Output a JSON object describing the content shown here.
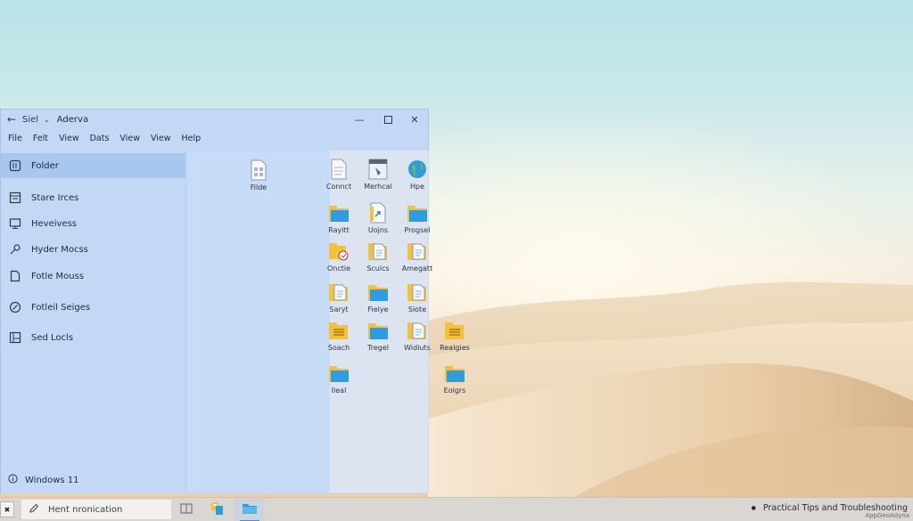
{
  "window": {
    "path_text": "Siel",
    "title": "Aderva",
    "menu": [
      "File",
      "Felt",
      "View",
      "Dats",
      "View",
      "View",
      "Help"
    ]
  },
  "nav": {
    "items": [
      {
        "label": "Folder",
        "icon": "folder-outline-icon"
      },
      {
        "label": "Stare Irces",
        "icon": "document-list-icon"
      },
      {
        "label": "Heveivess",
        "icon": "monitor-icon"
      },
      {
        "label": "Hyder Mocss",
        "icon": "link-icon"
      },
      {
        "label": "Fotle Mouss",
        "icon": "file-icon"
      },
      {
        "label": "Fotleil Seiges",
        "icon": "compass-icon"
      },
      {
        "label": "Sed Locls",
        "icon": "image-icon"
      }
    ],
    "footer": "Windows 11"
  },
  "mid_pane": {
    "item": {
      "label": "Filde",
      "icon": "document-icon"
    }
  },
  "files": [
    {
      "label": "Connct",
      "icon": "document-icon"
    },
    {
      "label": "Merhcal",
      "icon": "application-icon"
    },
    {
      "label": "Hpe",
      "icon": "globe-icon"
    },
    {
      "label": "Rayitt",
      "icon": "folder-icon"
    },
    {
      "label": "Uojns",
      "icon": "shortcut-file-icon"
    },
    {
      "label": "Progsel",
      "icon": "folder-icon"
    },
    {
      "label": "Onctie",
      "icon": "folder-badge-icon"
    },
    {
      "label": "Scuics",
      "icon": "folder-document-icon"
    },
    {
      "label": "Amegatt",
      "icon": "folder-document-icon"
    },
    {
      "label": "Saryt",
      "icon": "folder-document-icon"
    },
    {
      "label": "Fielye",
      "icon": "folder-icon"
    },
    {
      "label": "Siote",
      "icon": "folder-document-icon"
    },
    {
      "label": "Soach",
      "icon": "folder-lines-icon"
    },
    {
      "label": "Tregel",
      "icon": "folder-icon"
    },
    {
      "label": "Widiuts",
      "icon": "folder-document-icon"
    },
    {
      "label": "Realgies",
      "icon": "folder-lines-icon"
    },
    {
      "label": "Ileal",
      "icon": "folder-icon"
    },
    {
      "label": "Eolgrs",
      "icon": "folder-icon"
    }
  ],
  "taskbar": {
    "search_text": "Hent nronication",
    "tray_text": "Practical Tips and Troubleshooting",
    "watermark": "AppGeoAdyna"
  },
  "colors": {
    "folder_yellow": "#f3c13a",
    "folder_blue": "#2f9be0",
    "selection": "#a8c6ee",
    "window_bg": "#c3d8f4"
  }
}
